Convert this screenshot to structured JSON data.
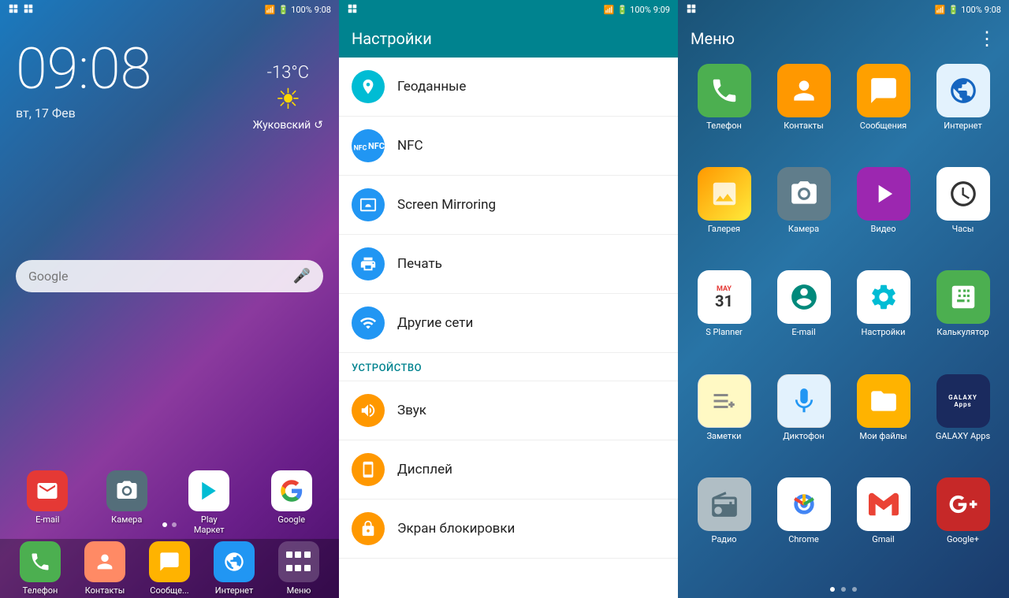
{
  "panel1": {
    "status": {
      "left_icons": "📷 🖼",
      "signal": "📶",
      "battery": "100%",
      "time": "9:08"
    },
    "time": "09:08",
    "date": "вт, 17 Фев",
    "weather": {
      "temp": "-13°C",
      "city": "Жуковский",
      "refresh_icon": "↺"
    },
    "search_placeholder": "Google",
    "apps": [
      {
        "id": "email",
        "label": "E-mail",
        "icon_class": "icon-email",
        "symbol": "✉"
      },
      {
        "id": "camera",
        "label": "Камера",
        "icon_class": "icon-camera",
        "symbol": "📷"
      },
      {
        "id": "play",
        "label": "Play Маркет",
        "icon_class": "icon-play",
        "symbol": "▶"
      },
      {
        "id": "google",
        "label": "Google",
        "icon_class": "icon-google",
        "symbol": "G"
      }
    ],
    "dock": [
      {
        "id": "phone",
        "label": "Телефон",
        "icon_class": "icon-phone",
        "symbol": "📞"
      },
      {
        "id": "contacts",
        "label": "Контакты",
        "icon_class": "icon-contacts",
        "symbol": "👤"
      },
      {
        "id": "messages",
        "label": "Сообще...",
        "icon_class": "icon-messages",
        "symbol": "💬"
      },
      {
        "id": "internet",
        "label": "Интернет",
        "icon_class": "icon-internet",
        "symbol": "🌐"
      },
      {
        "id": "menu",
        "label": "Меню",
        "icon_class": "icon-menu-btn",
        "symbol": "⋮⋮⋮"
      }
    ]
  },
  "panel2": {
    "status": {
      "battery": "100%",
      "time": "9:09"
    },
    "title": "Настройки",
    "items": [
      {
        "id": "geo",
        "label": "Геоданные",
        "icon_type": "teal",
        "symbol": "📍"
      },
      {
        "id": "nfc",
        "label": "NFC",
        "icon_type": "blue",
        "symbol": "📲"
      },
      {
        "id": "mirroring",
        "label": "Screen Mirroring",
        "icon_type": "blue",
        "symbol": "📺"
      },
      {
        "id": "print",
        "label": "Печать",
        "icon_type": "blue",
        "symbol": "🖨"
      },
      {
        "id": "networks",
        "label": "Другие сети",
        "icon_type": "blue",
        "symbol": "📡"
      }
    ],
    "section_label": "УСТРОЙСТВО",
    "device_items": [
      {
        "id": "sound",
        "label": "Звук",
        "icon_type": "orange",
        "symbol": "🔊"
      },
      {
        "id": "display",
        "label": "Дисплей",
        "icon_type": "orange",
        "symbol": "📱"
      },
      {
        "id": "lockscreen",
        "label": "Экран блокировки",
        "icon_type": "orange",
        "symbol": "🔒"
      }
    ]
  },
  "panel3": {
    "status": {
      "battery": "100%",
      "time": "9:08"
    },
    "title": "Меню",
    "more_icon": "⋮",
    "apps": [
      {
        "id": "phone",
        "label": "Телефон",
        "icon_class": "ig-phone",
        "symbol": "📞",
        "color": "#4caf50"
      },
      {
        "id": "contacts",
        "label": "Контакты",
        "icon_class": "ig-contacts",
        "symbol": "👤",
        "color": "#ff9800"
      },
      {
        "id": "messages",
        "label": "Сообщения",
        "icon_class": "ig-messages",
        "symbol": "✉",
        "color": "#ffa000"
      },
      {
        "id": "internet",
        "label": "Интернет",
        "icon_class": "ig-internet",
        "symbol": "🌐",
        "color": "#1565c0"
      },
      {
        "id": "gallery",
        "label": "Галерея",
        "icon_class": "ig-gallery",
        "symbol": "🖼",
        "color": "#ff9800"
      },
      {
        "id": "camera",
        "label": "Камера",
        "icon_class": "ig-camera",
        "symbol": "📷",
        "color": "#546e7a"
      },
      {
        "id": "video",
        "label": "Видео",
        "icon_class": "ig-video",
        "symbol": "▶",
        "color": "#9c27b0"
      },
      {
        "id": "clock",
        "label": "Часы",
        "icon_class": "ig-clock",
        "symbol": "🕐",
        "color": "white"
      },
      {
        "id": "splanner",
        "label": "S Planner",
        "icon_class": "ig-splanner",
        "symbol": "31",
        "color": "white"
      },
      {
        "id": "email2",
        "label": "E-mail",
        "icon_class": "ig-email2",
        "symbol": "@",
        "color": "white"
      },
      {
        "id": "settings2",
        "label": "Настройки",
        "icon_class": "ig-settings",
        "symbol": "⚙",
        "color": "white"
      },
      {
        "id": "calc",
        "label": "Калькулятор",
        "icon_class": "ig-calc",
        "symbol": "🔢",
        "color": "#4caf50"
      },
      {
        "id": "notes",
        "label": "Заметки",
        "icon_class": "ig-notes",
        "symbol": "📝",
        "color": "#fff9c4"
      },
      {
        "id": "recorder",
        "label": "Диктофон",
        "icon_class": "ig-recorder",
        "symbol": "🎤",
        "color": "#e3f2fd"
      },
      {
        "id": "myfiles",
        "label": "Мои файлы",
        "icon_class": "ig-myfiles",
        "symbol": "📁",
        "color": "#ffb300"
      },
      {
        "id": "galaxyapps",
        "label": "GALAXY Apps",
        "icon_class": "ig-galaxyapps",
        "symbol": "G",
        "color": "#1a2a5e"
      },
      {
        "id": "radio",
        "label": "Радио",
        "icon_class": "ig-radio",
        "symbol": "📻",
        "color": "#b0bec5"
      },
      {
        "id": "chrome",
        "label": "Chrome",
        "icon_class": "ig-chrome",
        "symbol": "◉",
        "color": "white"
      },
      {
        "id": "gmail",
        "label": "Gmail",
        "icon_class": "ig-gmail",
        "symbol": "M",
        "color": "white"
      },
      {
        "id": "gplus",
        "label": "Google+",
        "icon_class": "ig-gplus",
        "symbol": "g+",
        "color": "#c62828"
      }
    ],
    "dots": [
      true,
      false,
      false
    ]
  }
}
